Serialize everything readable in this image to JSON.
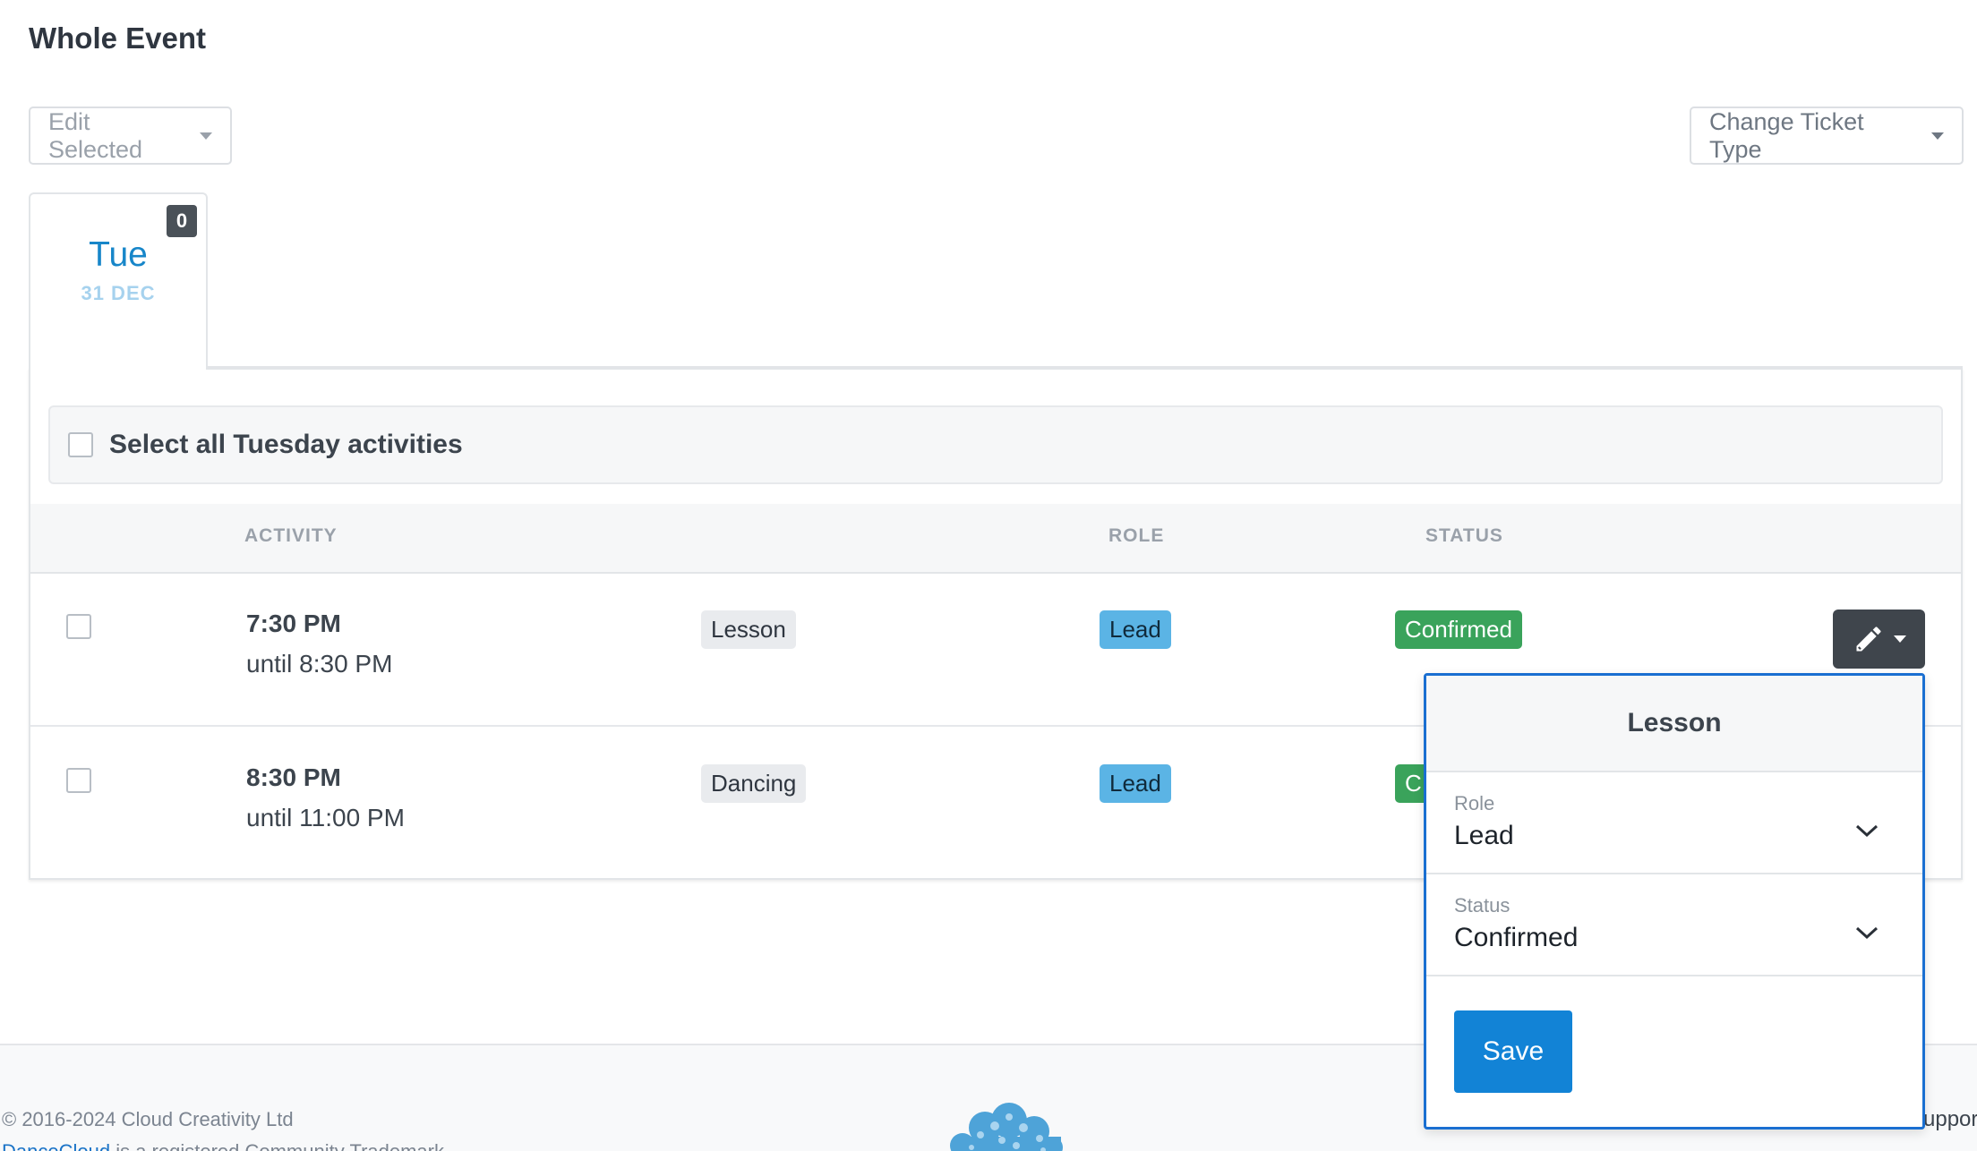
{
  "page": {
    "title": "Whole Event"
  },
  "toolbar": {
    "edit_selected_label": "Edit Selected",
    "change_ticket_type_label": "Change Ticket Type"
  },
  "day_tab": {
    "count": "0",
    "day": "Tue",
    "date": "31 DEC"
  },
  "select_all": {
    "label": "Select all Tuesday activities"
  },
  "table": {
    "headers": {
      "activity": "ACTIVITY",
      "role": "ROLE",
      "status": "STATUS"
    },
    "rows": [
      {
        "time": "7:30 PM",
        "until": "until 8:30 PM",
        "activity": "Lesson",
        "role": "Lead",
        "status": "Confirmed"
      },
      {
        "time": "8:30 PM",
        "until": "until 11:00 PM",
        "activity": "Dancing",
        "role": "Lead",
        "status": "C"
      }
    ]
  },
  "popover": {
    "title": "Lesson",
    "role_label": "Role",
    "role_value": "Lead",
    "status_label": "Status",
    "status_value": "Confirmed",
    "save_label": "Save"
  },
  "footer": {
    "copyright": "© 2016-2024 Cloud Creativity Ltd",
    "trademark_link": "DanceCloud",
    "trademark_text": " is a registered Community Trademark",
    "support_peek": "uppor"
  },
  "icons": {
    "edit": "pencil-icon",
    "chevron": "chevron-down-icon"
  },
  "colors": {
    "accent": "#1283d6",
    "role_tag": "#5bb4e5",
    "status_tag": "#3aa35b",
    "popover_border": "#1a6fd1"
  }
}
